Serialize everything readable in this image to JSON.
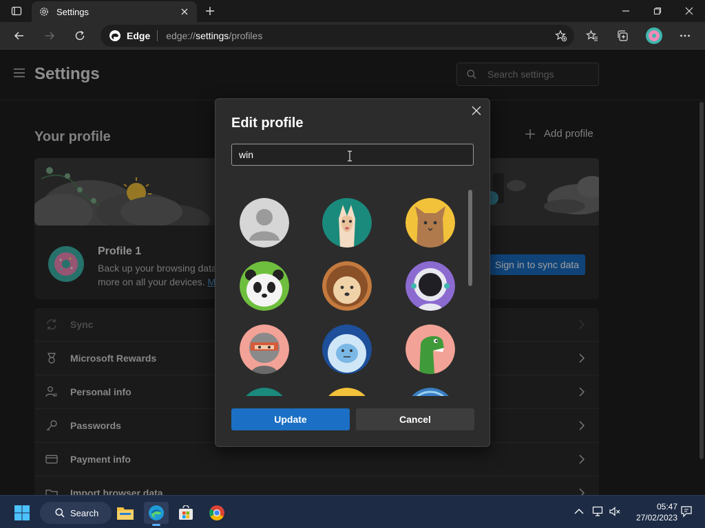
{
  "browser": {
    "tab_title": "Settings",
    "address": {
      "site_label": "Edge",
      "url_scheme": "edge://",
      "url_host": "settings",
      "url_path": "/profiles"
    }
  },
  "settings": {
    "title": "Settings",
    "search_placeholder": "Search settings",
    "section_title": "Your profile",
    "add_profile": "Add profile",
    "profile": {
      "name": "Profile 1",
      "desc_line1": "Back up your browsing data",
      "desc_line2": "more on all your devices.",
      "more_link": "M",
      "sync_button": "Sign in to sync data"
    },
    "menu": [
      {
        "label": "Sync",
        "icon": "sync-icon"
      },
      {
        "label": "Microsoft Rewards",
        "icon": "rewards-icon"
      },
      {
        "label": "Personal info",
        "icon": "person-icon"
      },
      {
        "label": "Passwords",
        "icon": "key-icon"
      },
      {
        "label": "Payment info",
        "icon": "card-icon"
      },
      {
        "label": "Import browser data",
        "icon": "import-icon"
      }
    ]
  },
  "dialog": {
    "title": "Edit profile",
    "name_value": "win",
    "avatars": [
      "default-person",
      "fox",
      "cat",
      "panda",
      "hedgehog",
      "astronaut",
      "ninja",
      "yeti",
      "dinosaur"
    ],
    "update_label": "Update",
    "cancel_label": "Cancel"
  },
  "taskbar": {
    "search_label": "Search",
    "time": "05:47",
    "date": "27/02/2023"
  },
  "colors": {
    "accent": "#1b6fc4",
    "background": "#202020",
    "taskbar": "#1d2b45"
  }
}
